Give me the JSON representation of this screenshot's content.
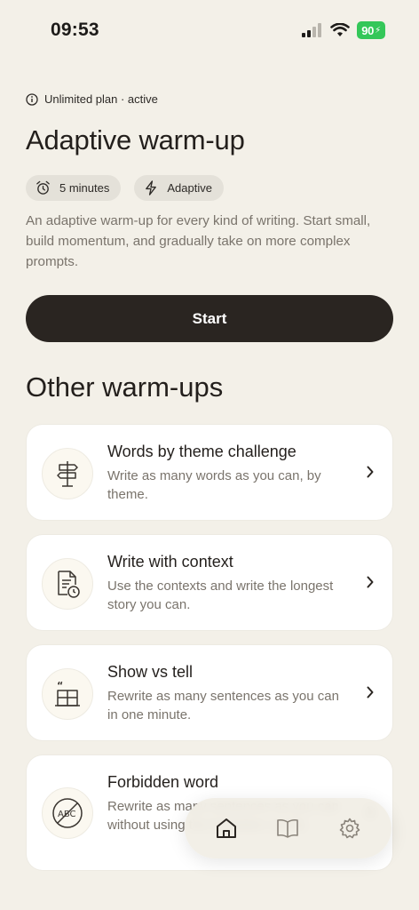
{
  "status_bar": {
    "time": "09:53",
    "battery": "90",
    "battery_color": "#34c759",
    "icons": [
      "signal-icon",
      "wifi-icon",
      "battery-icon"
    ]
  },
  "plan": {
    "label": "Unlimited plan · active",
    "icon": "info-icon"
  },
  "title": "Adaptive warm-up",
  "chips": [
    {
      "label": "5 minutes",
      "icon": "alarm-clock-icon"
    },
    {
      "label": "Adaptive",
      "icon": "lightning-icon"
    }
  ],
  "description": "An adaptive warm-up for every kind of writing. Start small, build momentum, and gradually take on more complex prompts.",
  "start_label": "Start",
  "section_title": "Other warm-ups",
  "warmups": [
    {
      "title": "Words by theme challenge",
      "description": "Write as many words as you can, by theme.",
      "icon": "signpost-icon"
    },
    {
      "title": "Write with context",
      "description": "Use the contexts and write the longest story you can.",
      "icon": "document-clock-icon"
    },
    {
      "title": "Show vs tell",
      "description": "Rewrite as many sentences as you can in one minute.",
      "icon": "quote-window-icon"
    },
    {
      "title": "Forbidden word",
      "description": "Rewrite as many sentences as you can without using the forbidden words.",
      "icon": "no-abc-icon"
    }
  ],
  "nav": {
    "items": [
      {
        "name": "home",
        "icon": "home-icon",
        "active": true
      },
      {
        "name": "library",
        "icon": "book-icon",
        "active": false
      },
      {
        "name": "settings",
        "icon": "gear-icon",
        "active": false
      }
    ]
  },
  "colors": {
    "background": "#f3f0e8",
    "primary_button": "#2a2521",
    "muted_text": "#7a746c"
  }
}
